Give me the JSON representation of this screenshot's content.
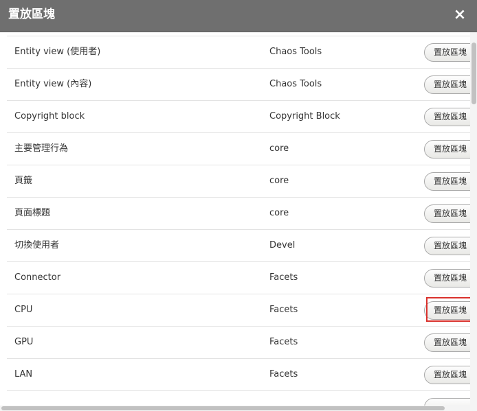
{
  "dialog": {
    "title": "置放區塊",
    "close_glyph": "×"
  },
  "rows": [
    {
      "name": "Entity view (使用者)",
      "category": "Chaos Tools",
      "button": "置放區塊"
    },
    {
      "name": "Entity view (內容)",
      "category": "Chaos Tools",
      "button": "置放區塊"
    },
    {
      "name": "Copyright block",
      "category": "Copyright Block",
      "button": "置放區塊"
    },
    {
      "name": "主要管理行為",
      "category": "core",
      "button": "置放區塊"
    },
    {
      "name": "頁籤",
      "category": "core",
      "button": "置放區塊"
    },
    {
      "name": "頁面標題",
      "category": "core",
      "button": "置放區塊"
    },
    {
      "name": "切換使用者",
      "category": "Devel",
      "button": "置放區塊"
    },
    {
      "name": "Connector",
      "category": "Facets",
      "button": "置放區塊"
    },
    {
      "name": "CPU",
      "category": "Facets",
      "button": "置放區塊"
    },
    {
      "name": "GPU",
      "category": "Facets",
      "button": "置放區塊"
    },
    {
      "name": "LAN",
      "category": "Facets",
      "button": "置放區塊"
    }
  ],
  "colors": {
    "titlebar": "#6f6f6f",
    "highlight": "#d9312c"
  }
}
